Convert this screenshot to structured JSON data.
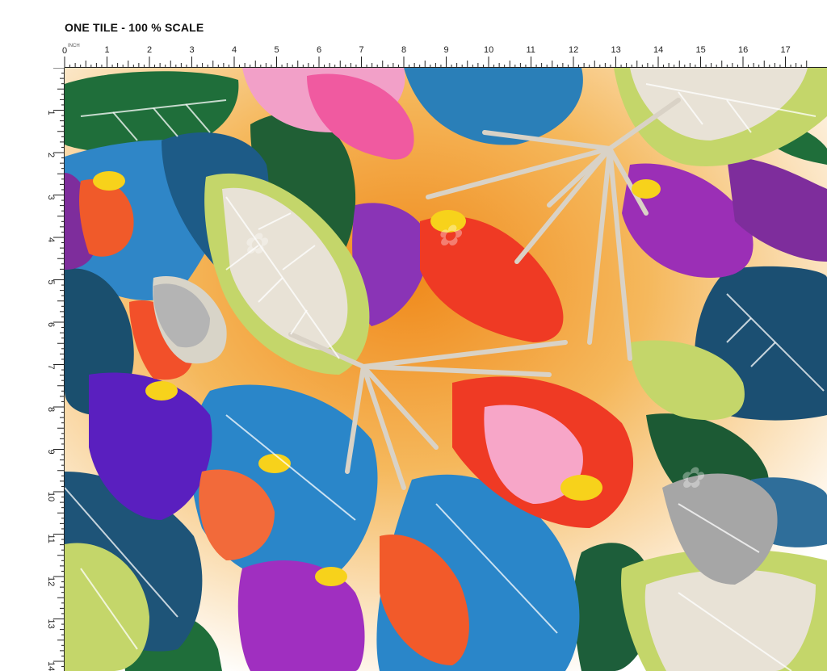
{
  "header": {
    "title": "ONE TILE - 100 % SCALE"
  },
  "ruler": {
    "unit_label": "INCH",
    "top_numbers": [
      "1",
      "2",
      "3",
      "4",
      "5",
      "6",
      "7",
      "8",
      "9",
      "10",
      "11",
      "12",
      "13",
      "14",
      "15",
      "16",
      "17"
    ],
    "left_numbers": [
      "1",
      "2",
      "3",
      "4",
      "5",
      "6",
      "7",
      "8",
      "9",
      "10",
      "11",
      "12",
      "13",
      "14"
    ]
  },
  "artwork": {
    "description_icon": "tropical-leaf-pattern-icon",
    "background_gradient": [
      "#ffffff",
      "#f5b85c",
      "#f08a1c"
    ],
    "palette": [
      "#1f6e3a",
      "#2f86c7",
      "#1a4f6e",
      "#c4d66a",
      "#e8e2d6",
      "#9b2fb6",
      "#ef3a24",
      "#f7d21b",
      "#6e1ea6",
      "#f05aa0"
    ]
  }
}
